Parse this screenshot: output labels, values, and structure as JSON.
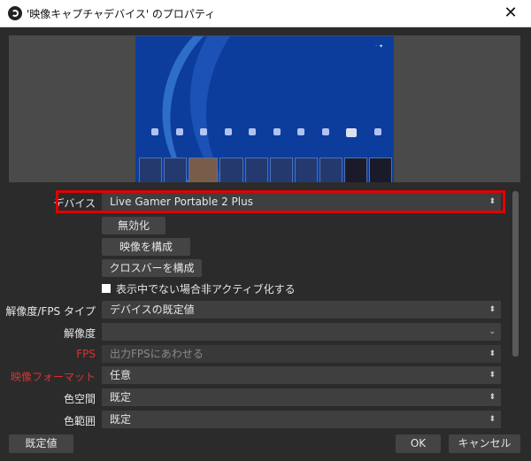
{
  "window": {
    "title": "'映像キャプチャデバイス' のプロパティ",
    "close": "✕"
  },
  "preview": {
    "status": "·  ✦"
  },
  "fields": {
    "device": {
      "label": "デバイス",
      "value": "Live Gamer Portable 2 Plus"
    },
    "deactivate": "無効化",
    "configure_video": "映像を構成",
    "configure_crossbar": "クロスバーを構成",
    "deactivate_when_hidden": "表示中でない場合非アクティブ化する",
    "res_fps_type": {
      "label": "解像度/FPS タイプ",
      "value": "デバイスの既定値"
    },
    "resolution": {
      "label": "解像度",
      "value": ""
    },
    "fps": {
      "label": "FPS",
      "value": "出力FPSにあわせる"
    },
    "video_format": {
      "label": "映像フォーマット",
      "value": "任意"
    },
    "color_space": {
      "label": "色空間",
      "value": "既定"
    },
    "color_range": {
      "label": "色範囲",
      "value": "既定"
    }
  },
  "footer": {
    "defaults": "既定値",
    "ok": "OK",
    "cancel": "キャンセル"
  },
  "colors": {
    "highlight": "#e00000",
    "disabled_label": "#e03030"
  }
}
